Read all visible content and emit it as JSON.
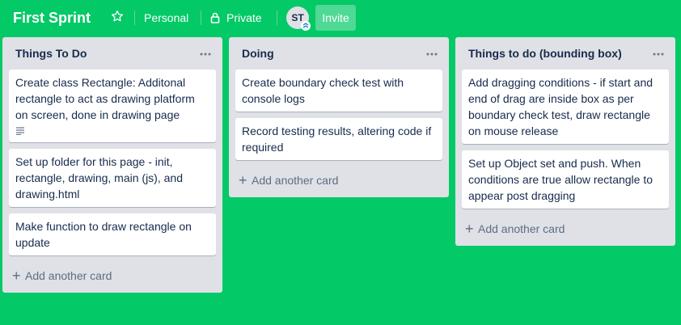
{
  "header": {
    "board_title": "First Sprint",
    "star_icon": "star-outline-icon",
    "team_label": "Personal",
    "visibility_label": "Private",
    "lock_icon": "lock-icon",
    "avatar_initials": "ST",
    "invite_label": "Invite"
  },
  "colors": {
    "board_background": "#03c966",
    "list_background": "#dfe1e6",
    "card_background": "#ffffff",
    "text_primary": "#172b4d",
    "text_muted": "#5e6c84"
  },
  "lists": [
    {
      "title": "Things To Do",
      "cards": [
        {
          "text": "Create class Rectangle: Additonal rectangle to act as drawing platform on screen, done in drawing page",
          "has_description": true
        },
        {
          "text": "Set up folder for this page - init, rectangle, drawing, main (js), and drawing.html",
          "has_description": false
        },
        {
          "text": "Make function to draw rectangle on update",
          "has_description": false
        }
      ],
      "add_card_label": "Add another card"
    },
    {
      "title": "Doing",
      "cards": [
        {
          "text": "Create boundary check test with console logs",
          "has_description": false
        },
        {
          "text": "Record testing results, altering code if required",
          "has_description": false
        }
      ],
      "add_card_label": "Add another card"
    },
    {
      "title": "Things to do (bounding box)",
      "cards": [
        {
          "text": "Add dragging conditions - if start and end of drag are inside box as per boundary check test, draw rectangle on mouse release",
          "has_description": false
        },
        {
          "text": "Set up Object set and push. When conditions are true allow rectangle to appear post dragging",
          "has_description": false
        }
      ],
      "add_card_label": "Add another card"
    }
  ]
}
